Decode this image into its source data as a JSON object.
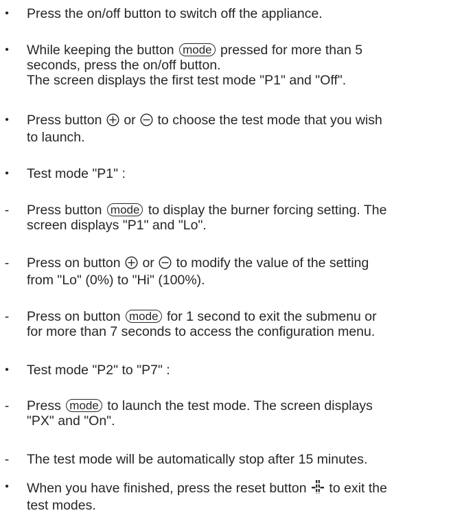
{
  "items": [
    {
      "marker": "•",
      "lines": [
        "Press the on/off button to switch off the appliance."
      ]
    },
    {
      "marker": "•",
      "line1_a": "While keeping the button",
      "mode": "mode",
      "line1_b": "pressed for more than 5",
      "line2": "seconds, press the on/off button.",
      "line3": "The screen displays the first test mode \"P1\" and \"Off\"."
    },
    {
      "marker": "•",
      "line1_a": "Press button",
      "or": "or",
      "line1_b": "to choose the test mode that you wish",
      "line2": "to launch."
    },
    {
      "marker": "•",
      "lines": [
        "Test mode \"P1\" :"
      ]
    },
    {
      "marker": "-",
      "line1_a": "Press button",
      "mode": "mode",
      "line1_b": "to display the burner forcing setting. The",
      "line2": "screen displays \"P1\" and \"Lo\"."
    },
    {
      "marker": "-",
      "line1_a": "Press on button",
      "or": "or",
      "line1_b": "to modify the value of the setting",
      "line2": "from \"Lo\" (0%) to \"Hi\" (100%)."
    },
    {
      "marker": "-",
      "line1_a": "Press on button",
      "mode": "mode",
      "line1_b": "for 1 second to exit the submenu or",
      "line2": "for more than 7 seconds to access the configuration menu."
    },
    {
      "marker": "•",
      "lines": [
        "Test mode \"P2\" to \"P7\" :"
      ]
    },
    {
      "marker": "-",
      "line1_a": "Press",
      "mode": "mode",
      "line1_b": "to launch the test mode. The screen displays",
      "line2": "\"PX\" and \"On\"."
    },
    {
      "marker": "-",
      "lines": [
        "The test mode will be automatically stop after 15 minutes."
      ]
    },
    {
      "marker": "•",
      "line1_a": "When you have finished, press the reset button",
      "line1_b": "to exit the",
      "line2": "test modes."
    }
  ],
  "icons": {
    "plus": "plus-circle-icon",
    "minus": "minus-circle-icon",
    "reset": "reset-button-icon"
  }
}
